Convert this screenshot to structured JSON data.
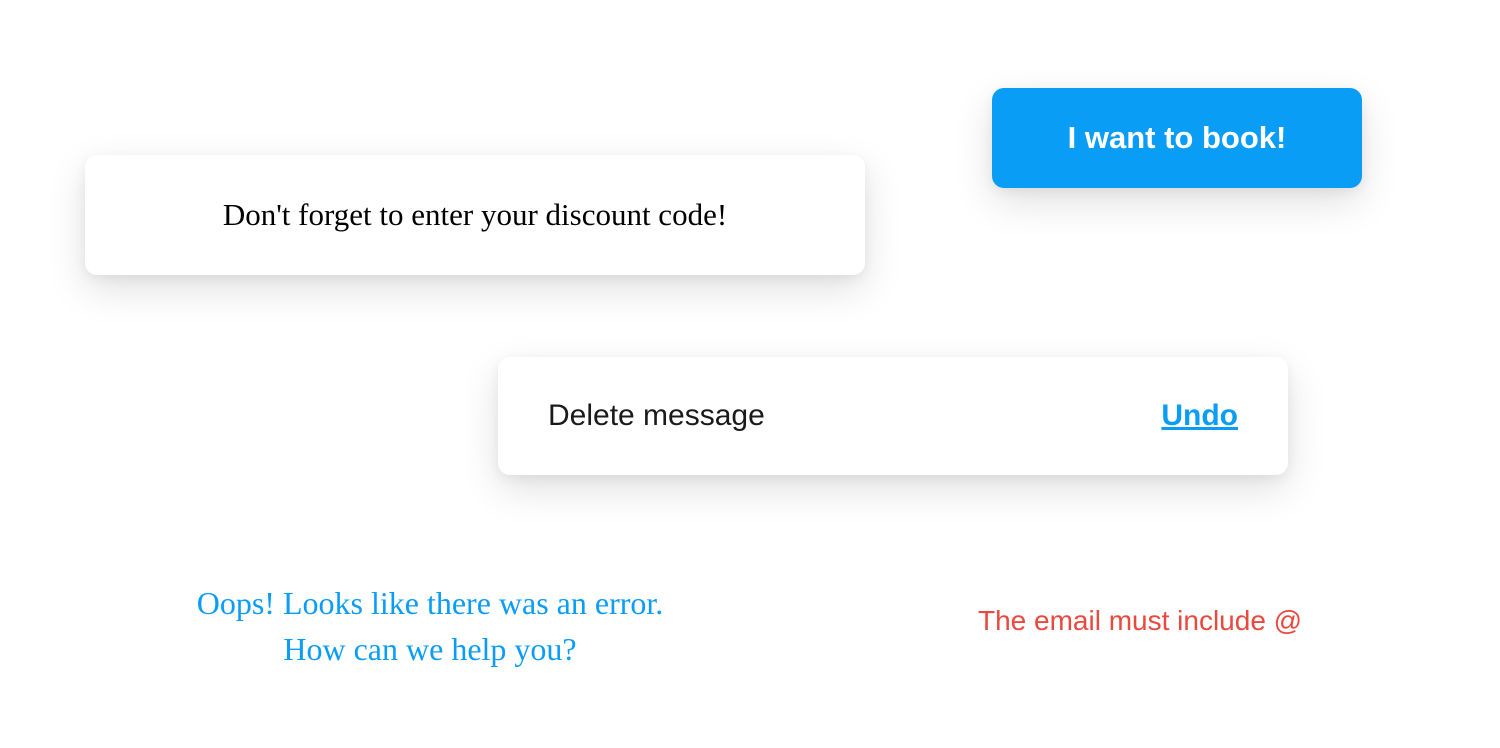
{
  "discount": {
    "message": "Don't forget to enter your discount code!"
  },
  "cta": {
    "book_label": "I want to book!"
  },
  "toast": {
    "message": "Delete message",
    "action_label": "Undo"
  },
  "error_help": {
    "line1": "Oops! Looks like there was an error.",
    "line2": "How can we help you?"
  },
  "validation": {
    "email_error": "The email must include @"
  }
}
